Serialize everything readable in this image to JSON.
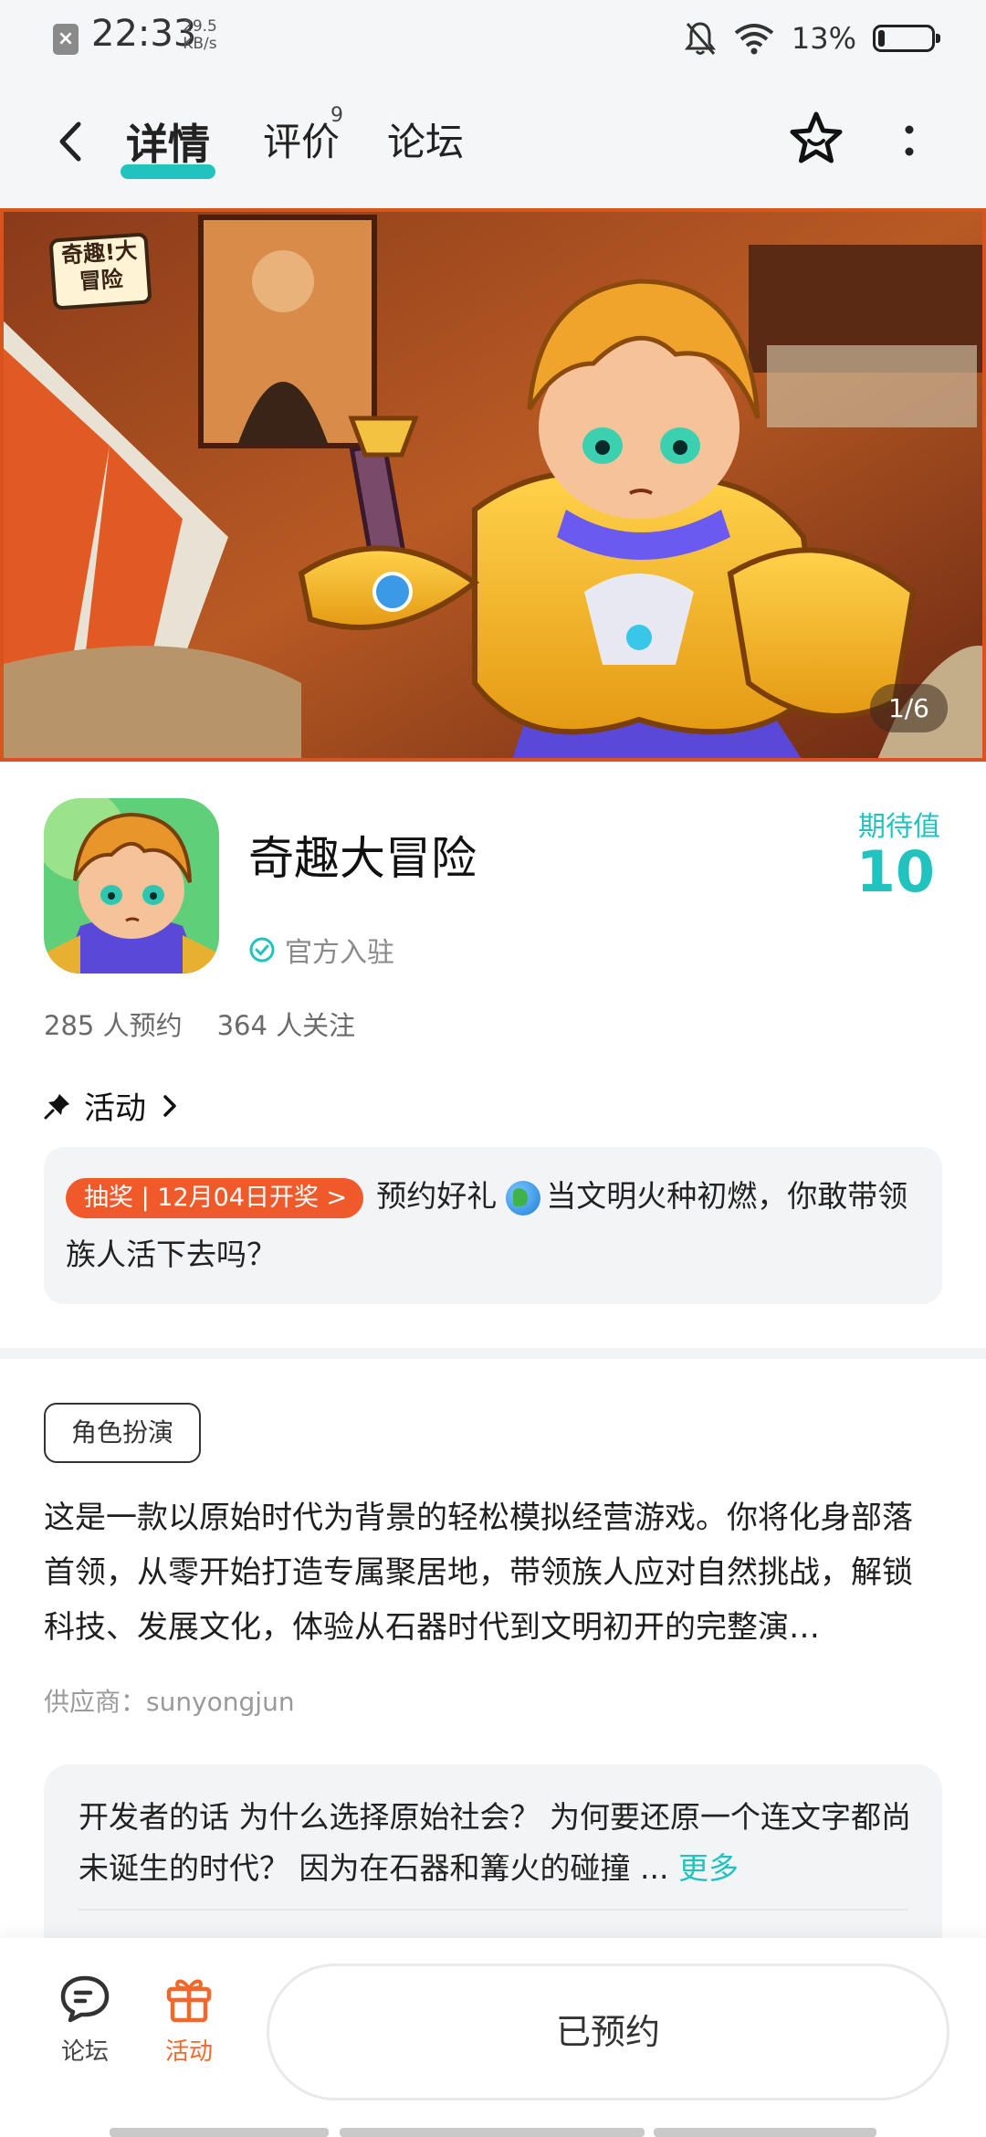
{
  "status_bar": {
    "time": "22:33",
    "speed_value": "29.5",
    "speed_unit": "KB/s",
    "battery_percent": "13%",
    "battery_level": 0.13
  },
  "nav": {
    "tabs": [
      {
        "label": "详情",
        "active": true
      },
      {
        "label": "评价",
        "badge": "9"
      },
      {
        "label": "论坛"
      }
    ]
  },
  "banner": {
    "counter": "1/6",
    "logo_text": "奇趣!大冒险"
  },
  "game": {
    "title": "奇趣大冒险",
    "official_label": "官方入驻",
    "expect_label": "期待值",
    "expect_value": "10",
    "reservations": "285 人预约",
    "followers": "364 人关注"
  },
  "activity": {
    "header": "活动",
    "tag": "抽奖 | 12月04日开奖 >",
    "text_before_icon": "预约好礼",
    "text_after_icon": "当文明火种初燃，你敢带领族人活下去吗？"
  },
  "details": {
    "genre_tag": "角色扮演",
    "description": "这是一款以原始时代为背景的轻松模拟经营游戏。你将化身部落首领，从零开始打造专属聚居地，带领族人应对自然挑战，解锁科技、发展文化，体验从石器时代到文明初开的完整演…",
    "supplier": "供应商：sunyongjun",
    "developer_note": "开发者的话  为什么选择原始社会？ 为何要还原一个连文字都尚未诞生的时代？ 因为在石器和篝火的碰撞 ...",
    "more_link": "更多"
  },
  "bottom_bar": {
    "forum_label": "论坛",
    "activity_label": "活动",
    "reserve_label": "已预约"
  },
  "colors": {
    "accent": "#22c3be",
    "orange": "#f05a2a"
  }
}
